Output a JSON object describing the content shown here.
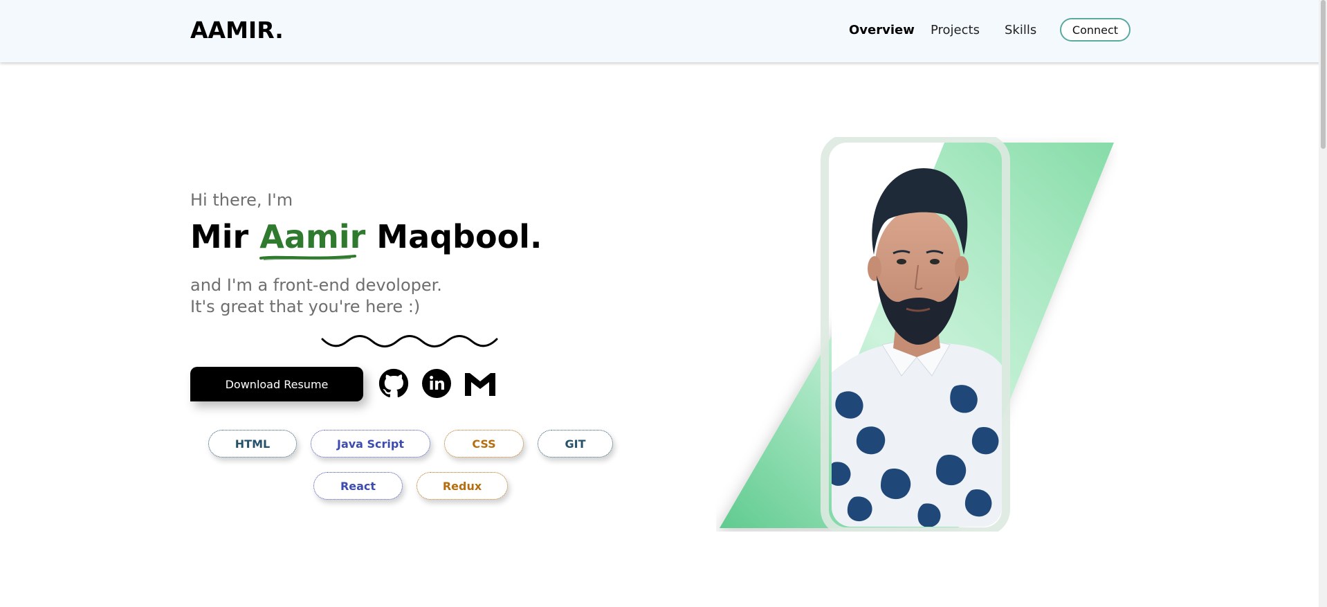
{
  "header": {
    "logo": "AAMIR.",
    "nav": [
      {
        "label": "Overview",
        "active": true
      },
      {
        "label": "Projects",
        "active": false
      },
      {
        "label": "Skills",
        "active": false
      }
    ],
    "connect_label": "Connect"
  },
  "hero": {
    "greeting": "Hi there, I'm",
    "name_prefix": "Mir ",
    "name_highlight": "Aamir",
    "name_suffix": " Maqbool.",
    "tagline_line1": "and I'm a front-end devoloper.",
    "tagline_line2": "It's great that you're here :)",
    "download_label": "Download Resume",
    "social_icons": [
      "github-icon",
      "linkedin-icon",
      "gmail-icon"
    ]
  },
  "skills": [
    {
      "label": "HTML",
      "tone": "teal"
    },
    {
      "label": "Java Script",
      "tone": "blue"
    },
    {
      "label": "CSS",
      "tone": "orange"
    },
    {
      "label": "GIT",
      "tone": "teal"
    },
    {
      "label": "React",
      "tone": "blue"
    },
    {
      "label": "Redux",
      "tone": "orange"
    }
  ],
  "colors": {
    "accent_green": "#2f7a2f",
    "header_bg": "#f4f9fd",
    "connect_border": "#5aa9a0",
    "panel_green": "#86dca8",
    "skill_teal": "#25526a",
    "skill_blue": "#3d4cb0",
    "skill_orange": "#b46e10"
  }
}
